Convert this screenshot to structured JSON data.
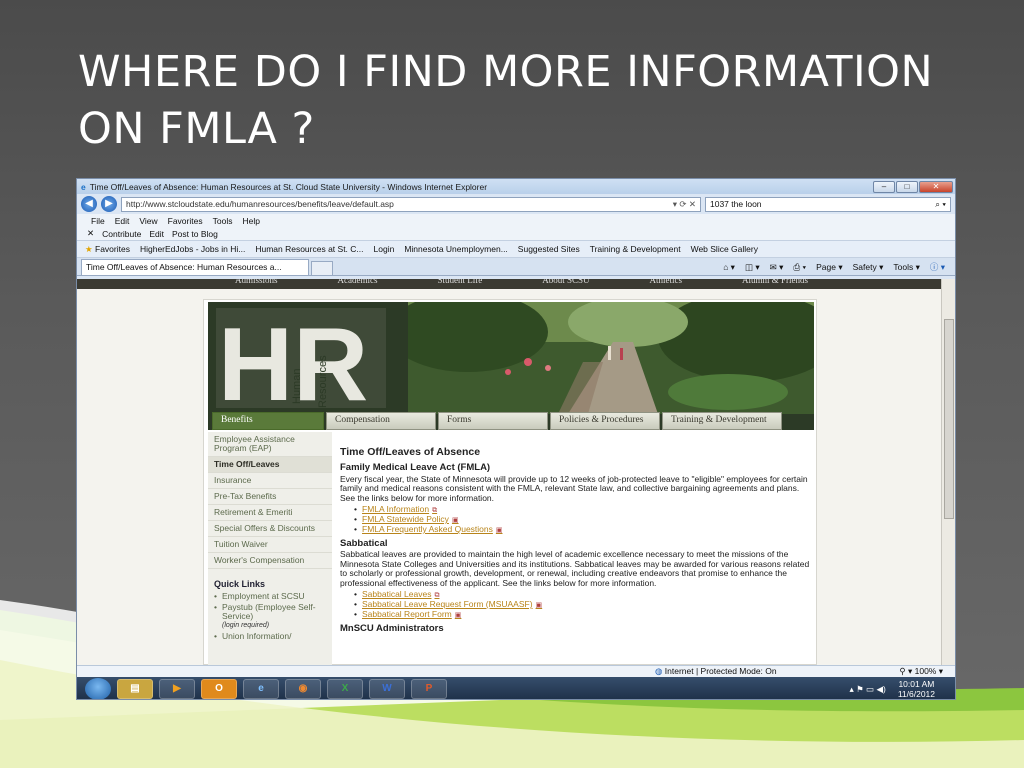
{
  "slide": {
    "title_line1": "WHERE DO I FIND MORE INFORMATION",
    "title_line2": "ON FMLA ?"
  },
  "browser": {
    "window_title": "Time Off/Leaves of Absence: Human Resources at St. Cloud State University - Windows Internet Explorer",
    "url": "http://www.stcloudstate.edu/humanresources/benefits/leave/default.asp",
    "search_value": "1037 the loon",
    "menu": [
      "File",
      "Edit",
      "View",
      "Favorites",
      "Tools",
      "Help"
    ],
    "contribute": [
      "Contribute",
      "Edit",
      "Post to Blog"
    ],
    "favorites": [
      "Favorites",
      "HigherEdJobs - Jobs in Hi...",
      "Human Resources at St. C...",
      "Login",
      "Minnesota Unemploymen...",
      "Suggested Sites",
      "Training & Development",
      "Web Slice Gallery"
    ],
    "tab_title": "Time Off/Leaves of Absence: Human Resources a...",
    "commands": [
      "Page",
      "Safety",
      "Tools"
    ],
    "status_zone": "Internet | Protected Mode: On",
    "zoom": "100%"
  },
  "site": {
    "top_nav": [
      "Admissions",
      "Academics",
      "Student Life",
      "About SCSU",
      "Athletics",
      "Alumni & Friends"
    ],
    "logo_letters": "HR",
    "logo_vertical1": "Human",
    "logo_vertical2": "Resources",
    "tabs": [
      "Benefits",
      "Compensation",
      "Forms",
      "Policies & Procedures",
      "Training & Development"
    ],
    "sidebar": [
      "Employee Assistance Program (EAP)",
      "Time Off/Leaves",
      "Insurance",
      "Pre-Tax Benefits",
      "Retirement & Emeriti",
      "Special Offers & Discounts",
      "Tuition Waiver",
      "Worker's Compensation"
    ],
    "quick_links_title": "Quick Links",
    "quick_links": [
      "Employment at SCSU",
      "Paystub (Employee Self-Service)",
      "Union Information/"
    ],
    "quick_note": "(login required)",
    "page_title": "Time Off/Leaves of Absence",
    "fmla_heading": "Family Medical Leave Act (FMLA)",
    "fmla_text": "Every fiscal year, the State of Minnesota will provide up to 12 weeks of job-protected leave to \"eligible\" employees for certain family and medical reasons consistent with the FMLA, relevant State law, and collective bargaining agreements and plans. See the links below for more information.",
    "fmla_links": [
      "FMLA Information",
      "FMLA Statewide Policy",
      "FMLA Frequently Asked Questions"
    ],
    "sabbatical_heading": "Sabbatical",
    "sabbatical_text": "Sabbatical leaves are provided to maintain the high level of academic excellence necessary to meet the missions of the Minnesota State Colleges and Universities and its institutions. Sabbatical leaves may be awarded for various reasons related to scholarly or professional growth, development, or renewal, including creative endeavors that promise to enhance the professional effectiveness of the applicant. See the links below for more information.",
    "sabbatical_links": [
      "Sabbatical Leaves",
      "Sabbatical Leave Request Form (MSUAASF)",
      "Sabbatical Report Form"
    ],
    "mnscu_heading": "MnSCU Administrators"
  },
  "taskbar": {
    "time": "10:01 AM",
    "date": "11/6/2012",
    "apps": [
      "explorer-icon",
      "media-icon",
      "outlook-icon",
      "ie-icon",
      "firefox-icon",
      "excel-icon",
      "word-icon",
      "powerpoint-icon"
    ]
  }
}
